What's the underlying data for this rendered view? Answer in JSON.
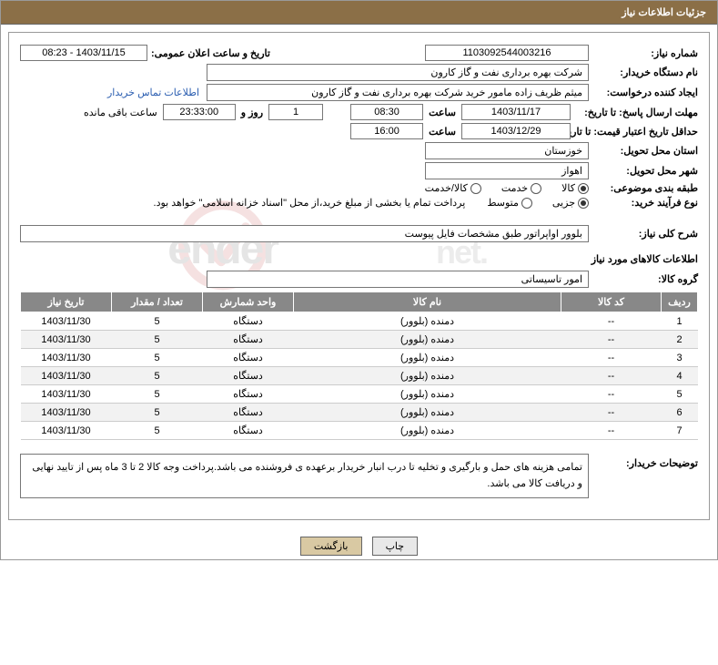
{
  "header": {
    "title": "جزئیات اطلاعات نیاز"
  },
  "request": {
    "number_label": "شماره نیاز:",
    "number": "1103092544003216",
    "announce_label": "تاریخ و ساعت اعلان عمومی:",
    "announce_value": "1403/11/15 - 08:23",
    "buyer_label": "نام دستگاه خریدار:",
    "buyer": "شرکت بهره برداری نفت و گاز کارون",
    "creator_label": "ایجاد کننده درخواست:",
    "creator": "میثم ظریف زاده مامور خرید شرکت بهره برداری نفت و گاز کارون",
    "contact_link": "اطلاعات تماس خریدار",
    "deadline_label": "مهلت ارسال پاسخ: تا تاریخ:",
    "deadline_date": "1403/11/17",
    "hour_label": "ساعت",
    "deadline_hour": "08:30",
    "days_val": "1",
    "days_label": "روز و",
    "remain_time": "23:33:00",
    "remain_label": "ساعت باقی مانده",
    "validity_label": "حداقل تاریخ اعتبار قیمت: تا تاریخ:",
    "validity_date": "1403/12/29",
    "validity_hour": "16:00",
    "province_label": "استان محل تحویل:",
    "province": "خوزستان",
    "city_label": "شهر محل تحویل:",
    "city": "اهواز",
    "category_label": "طبقه بندی موضوعی:",
    "cat_goods": "کالا",
    "cat_service": "خدمت",
    "cat_goods_service": "کالا/خدمت",
    "purchase_type_label": "نوع فرآیند خرید:",
    "pt_small": "جزیی",
    "pt_medium": "متوسط",
    "payment_note": "پرداخت تمام یا بخشی از مبلغ خرید،از محل \"اسناد خزانه اسلامی\" خواهد بود.",
    "desc_label": "شرح کلی نیاز:",
    "desc": "بلوور اواپراتور طبق مشخصات فایل پیوست",
    "goods_section": "اطلاعات کالاهای مورد نیاز",
    "group_label": "گروه کالا:",
    "group": "امور تاسیساتی",
    "buyer_notes_label": "توضیحات خریدار:",
    "buyer_notes": "تمامی هزینه های حمل و بارگیری و تخلیه تا درب انبار خریدار برعهده ی فروشنده می باشد.پرداخت وجه کالا 2 تا 3 ماه پس از تایید نهایی و دریافت کالا می باشد."
  },
  "table": {
    "headers": {
      "row": "ردیف",
      "code": "کد کالا",
      "name": "نام کالا",
      "unit": "واحد شمارش",
      "qty": "تعداد / مقدار",
      "date": "تاریخ نیاز"
    },
    "rows": [
      {
        "n": "1",
        "code": "--",
        "name": "دمنده (بلوور)",
        "unit": "دستگاه",
        "qty": "5",
        "date": "1403/11/30"
      },
      {
        "n": "2",
        "code": "--",
        "name": "دمنده (بلوور)",
        "unit": "دستگاه",
        "qty": "5",
        "date": "1403/11/30"
      },
      {
        "n": "3",
        "code": "--",
        "name": "دمنده (بلوور)",
        "unit": "دستگاه",
        "qty": "5",
        "date": "1403/11/30"
      },
      {
        "n": "4",
        "code": "--",
        "name": "دمنده (بلوور)",
        "unit": "دستگاه",
        "qty": "5",
        "date": "1403/11/30"
      },
      {
        "n": "5",
        "code": "--",
        "name": "دمنده (بلوور)",
        "unit": "دستگاه",
        "qty": "5",
        "date": "1403/11/30"
      },
      {
        "n": "6",
        "code": "--",
        "name": "دمنده (بلوور)",
        "unit": "دستگاه",
        "qty": "5",
        "date": "1403/11/30"
      },
      {
        "n": "7",
        "code": "--",
        "name": "دمنده (بلوور)",
        "unit": "دستگاه",
        "qty": "5",
        "date": "1403/11/30"
      }
    ]
  },
  "buttons": {
    "print": "چاپ",
    "back": "بازگشت"
  },
  "watermark": "AriaTender.net"
}
